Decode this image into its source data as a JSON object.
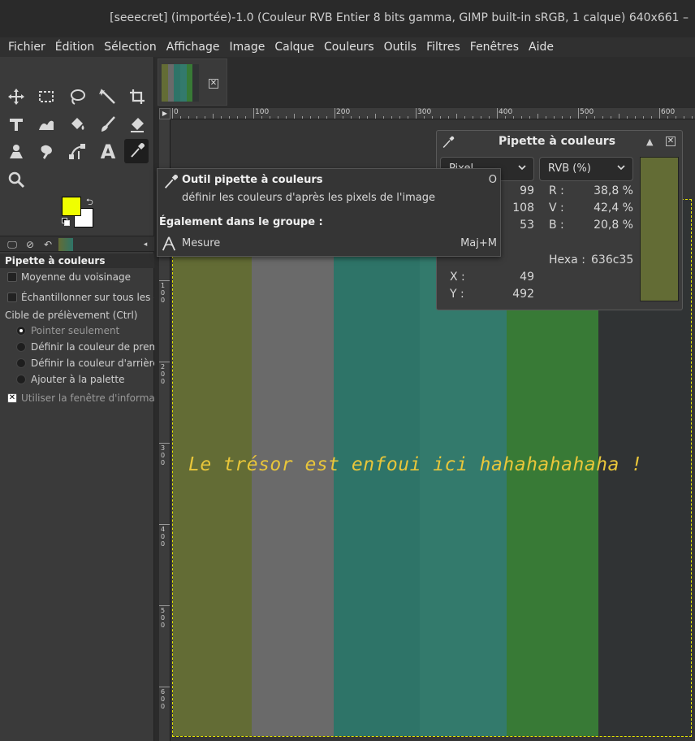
{
  "window": {
    "title": "[seeecret] (importée)-1.0 (Couleur RVB Entier 8 bits gamma, GIMP built-in sRGB, 1 calque) 640x661 –"
  },
  "menubar": {
    "items": [
      "Fichier",
      "Édition",
      "Sélection",
      "Affichage",
      "Image",
      "Calque",
      "Couleurs",
      "Outils",
      "Filtres",
      "Fenêtres",
      "Aide"
    ]
  },
  "toolbox": {
    "tools": [
      {
        "name": "move-icon"
      },
      {
        "name": "rect-select-icon"
      },
      {
        "name": "lasso-icon"
      },
      {
        "name": "fuzzy-select-icon"
      },
      {
        "name": "crop-icon"
      },
      {
        "name": "transform-icon"
      },
      {
        "name": "warp-icon"
      },
      {
        "name": "bucket-fill-icon"
      },
      {
        "name": "paintbrush-icon"
      },
      {
        "name": "eraser-icon"
      },
      {
        "name": "clone-icon"
      },
      {
        "name": "smudge-icon"
      },
      {
        "name": "paths-icon"
      },
      {
        "name": "text-icon",
        "glyph": "A"
      },
      {
        "name": "color-picker-icon"
      },
      {
        "name": "zoom-icon"
      }
    ],
    "foreground_color": "#f0ff00",
    "background_color": "#ffffff"
  },
  "tool_options": {
    "title": "Pipette à couleurs",
    "sample_average": "Moyenne du voisinage",
    "sample_merged": "Échantillonner sur tous les cal",
    "pick_target_label": "Cible de prélèvement  (Ctrl)",
    "targets": [
      {
        "label": "Pointer seulement",
        "checked": true
      },
      {
        "label": "Définir la couleur de premie",
        "checked": false
      },
      {
        "label": "Définir la couleur d'arrière-p",
        "checked": false
      },
      {
        "label": "Ajouter à la palette",
        "checked": false
      }
    ],
    "use_info_window": "Utiliser la fenêtre d'informatio",
    "use_info_window_checked": true
  },
  "image": {
    "stripes": [
      {
        "color": "#636c35",
        "width": 97
      },
      {
        "color": "#6a6a6a",
        "width": 102
      },
      {
        "color": "#2e7468",
        "width": 106
      },
      {
        "color": "#337a6c",
        "width": 107
      },
      {
        "color": "#387a36",
        "width": 114
      },
      {
        "color": "#303334",
        "width": 114
      }
    ],
    "secret_text": "Le trésor est enfoui ici hahahahahaha !"
  },
  "rulers": {
    "horizontal": [
      "0",
      "100",
      "200",
      "300",
      "400",
      "500",
      "600"
    ],
    "vertical": [
      "100",
      "200",
      "300",
      "400",
      "500",
      "600"
    ]
  },
  "tooltip": {
    "title": "Outil pipette à couleurs",
    "shortcut": "O",
    "description": "définir les couleurs d'après les pixels de l'image",
    "group_label": "Également dans le groupe :",
    "measure_label": "Mesure",
    "measure_shortcut": "Maj+M"
  },
  "picker": {
    "title": "Pipette à couleurs",
    "left_mode": "Pixel",
    "right_mode": "RVB (%)",
    "pixel_r": "99",
    "pixel_v": "108",
    "pixel_b": "53",
    "pct_r_label": "R :",
    "pct_v_label": "V :",
    "pct_b_label": "B :",
    "pct_r": "38,8 %",
    "pct_v": "42,4 %",
    "pct_b": "20,8 %",
    "hexa_label": "Hexa :",
    "hexa_value": "636c35",
    "x_label": "X :",
    "x_value": "49",
    "y_label": "Y :",
    "y_value": "492",
    "swatch_color": "#636c35"
  }
}
